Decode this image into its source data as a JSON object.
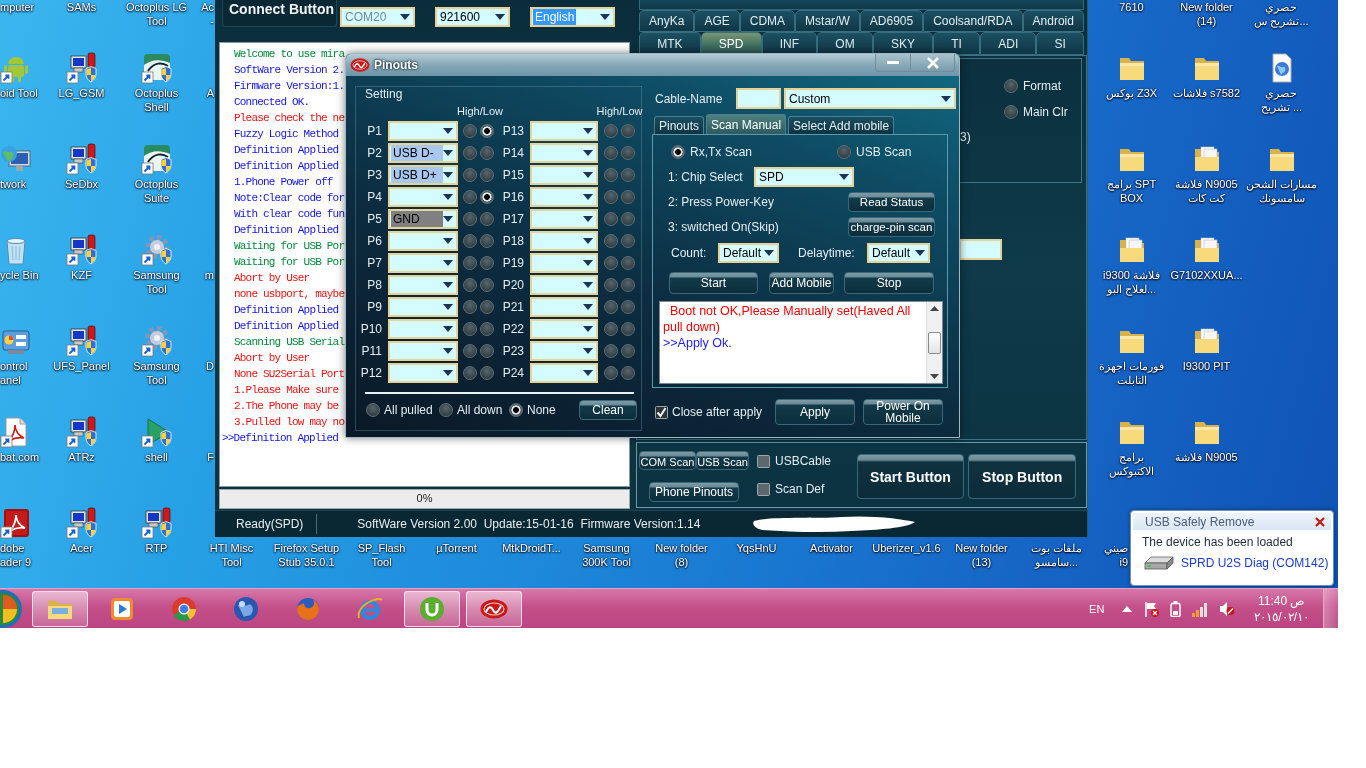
{
  "desktop": {
    "icons": [
      {
        "kind": "label",
        "label": "mputer"
      },
      {
        "kind": "android",
        "label": "oid Tool"
      },
      {
        "kind": "network",
        "label": "twork"
      },
      {
        "kind": "recycle",
        "label": "ycle Bin"
      },
      {
        "kind": "control",
        "label": "ontrol\nanel"
      },
      {
        "kind": "acrobat",
        "label": "bat.com"
      },
      {
        "kind": "reader",
        "label": "dobe\nader 9"
      },
      {
        "kind": "label",
        "label": "SAMs"
      },
      {
        "kind": "app",
        "label": "LG_GSM"
      },
      {
        "kind": "app",
        "label": "SeDbx"
      },
      {
        "kind": "app",
        "label": "KZF"
      },
      {
        "kind": "app",
        "label": "UFS_Panel"
      },
      {
        "kind": "app",
        "label": "ATRz"
      },
      {
        "kind": "app",
        "label": "Acer"
      },
      {
        "kind": "label",
        "label": "Octoplus LG\nTool"
      },
      {
        "kind": "octoplus",
        "label": "Octoplus\nShell"
      },
      {
        "kind": "octoplus",
        "label": "Octoplus\nSuite"
      },
      {
        "kind": "gear",
        "label": "Samsung\nTool"
      },
      {
        "kind": "gear",
        "label": "Samsung\nTool"
      },
      {
        "kind": "shell",
        "label": "shell"
      },
      {
        "kind": "app",
        "label": "RTP"
      },
      {
        "kind": "fragment",
        "label": "Ac\n-"
      },
      {
        "kind": "fragment",
        "label": "A"
      },
      {
        "kind": "fragment",
        "label": "m"
      },
      {
        "kind": "fragment",
        "label": "D"
      },
      {
        "kind": "fragment",
        "label": "F"
      },
      {
        "kind": "label",
        "label": "HTI Misc\nTool"
      },
      {
        "kind": "label",
        "label": "Firefox Setup\nStub 35.0.1"
      },
      {
        "kind": "label",
        "label": "SP_Flash\nTool"
      },
      {
        "kind": "label",
        "label": "µTorrent"
      },
      {
        "kind": "label",
        "label": "MtkDroidT..."
      },
      {
        "kind": "label",
        "label": "Samsung\n300K Tool"
      },
      {
        "kind": "label",
        "label": "New folder\n(8)"
      },
      {
        "kind": "label",
        "label": "YqsHnU"
      },
      {
        "kind": "label",
        "label": "Activator"
      },
      {
        "kind": "label",
        "label": "Uberizer_v1.6"
      },
      {
        "kind": "label",
        "label": "New folder\n(13)"
      },
      {
        "kind": "label",
        "label": "ملفات بوت\nسامسو..."
      },
      {
        "kind": "label",
        "label": "7610"
      },
      {
        "kind": "folder",
        "label": "بوكس Z3X"
      },
      {
        "kind": "folder",
        "label": "برامج SPT\nBOX"
      },
      {
        "kind": "files",
        "label": "i9300 فلاشة\nلعلاج البو..."
      },
      {
        "kind": "folder",
        "label": "فورمات اجهزة\nالتابلت"
      },
      {
        "kind": "folder",
        "label": "برامج\nالاكتبوكس"
      },
      {
        "kind": "covered",
        "label": "صيني\ni9"
      },
      {
        "kind": "label",
        "label": "New folder\n(14)"
      },
      {
        "kind": "folder",
        "label": "فلاشات s7582"
      },
      {
        "kind": "files",
        "label": "فلاشة N9005\nكت كات"
      },
      {
        "kind": "files",
        "label": "G7102XXUA..."
      },
      {
        "kind": "files",
        "label": "I9300 PIT"
      },
      {
        "kind": "folder",
        "label": "فلاشة N9005"
      },
      {
        "kind": "label",
        "label": "حصري\nتشريح س..."
      },
      {
        "kind": "web",
        "label": "حصري\nتشريح ..."
      },
      {
        "kind": "folder",
        "label": "مسارات الشحن\nسامسونك"
      }
    ]
  },
  "app": {
    "connect_button": "Connect Button",
    "ports": [
      {
        "value": "COM20",
        "disabled": true,
        "focused": false
      },
      {
        "value": "921600",
        "disabled": false,
        "focused": false
      },
      {
        "value": "English",
        "disabled": false,
        "focused": true
      }
    ],
    "platform_tabs": [
      {
        "tabs": [
          {
            "label": "AnyKa",
            "selected": false
          },
          {
            "label": "AGE",
            "selected": false
          },
          {
            "label": "CDMA",
            "selected": false
          },
          {
            "label": "Mstar/W",
            "selected": false
          },
          {
            "label": "AD6905",
            "selected": false
          },
          {
            "label": "Coolsand/RDA",
            "selected": false
          },
          {
            "label": "Android",
            "selected": false
          }
        ]
      },
      {
        "tabs": [
          {
            "label": "MTK",
            "selected": false
          },
          {
            "label": "SPD",
            "selected": true
          },
          {
            "label": "INF",
            "selected": false
          },
          {
            "label": "OM",
            "selected": false
          },
          {
            "label": "SKY",
            "selected": false
          },
          {
            "label": "TI",
            "selected": false
          },
          {
            "label": "ADI",
            "selected": false
          },
          {
            "label": "SI",
            "selected": false
          }
        ]
      }
    ],
    "log": [
      {
        "text": "Welcome to use mira",
        "kind": "status"
      },
      {
        "text": "SoftWare Version 2.",
        "kind": "info"
      },
      {
        "text": "Firmware Version:1.",
        "kind": "info"
      },
      {
        "text": "Connected OK.",
        "kind": "info"
      },
      {
        "text": "Please check the ne",
        "kind": "error"
      },
      {
        "text": "Fuzzy Logic Method",
        "kind": "info"
      },
      {
        "text": "Definition Applied",
        "kind": "info"
      },
      {
        "text": "Definition Applied",
        "kind": "info"
      },
      {
        "text": "1.Phone Power off",
        "kind": "info"
      },
      {
        "text": "Note:Clear code for",
        "kind": "info"
      },
      {
        "text": "With clear code fun",
        "kind": "info"
      },
      {
        "text": "Definition Applied",
        "kind": "info"
      },
      {
        "text": "Waiting for USB Por",
        "kind": "status"
      },
      {
        "text": "Waiting for USB Por",
        "kind": "status"
      },
      {
        "text": "Abort by User",
        "kind": "error"
      },
      {
        "text": "none usbport, maybe",
        "kind": "error"
      },
      {
        "text": "Definition Applied",
        "kind": "info"
      },
      {
        "text": "Definition Applied",
        "kind": "info"
      },
      {
        "text": "Scanning USB Serial",
        "kind": "status"
      },
      {
        "text": "Abort by User",
        "kind": "error"
      },
      {
        "text": "None SU2Serial Port",
        "kind": "error"
      },
      {
        "text": "1.Please Make sure",
        "kind": "error"
      },
      {
        "text": "2.The Phone may be",
        "kind": "error"
      },
      {
        "text": "3.Pulled low may no",
        "kind": "error"
      },
      {
        "text": ">>Definition Applied",
        "kind": "prompt"
      }
    ],
    "progress": {
      "text": "0%",
      "level": 0
    },
    "side_panel": {
      "options": [
        {
          "label": "Format",
          "selected": false
        },
        {
          "label": "Main Clr",
          "selected": false
        }
      ],
      "note": "3)"
    },
    "bottom_panel": {
      "scan_buttons": [
        "COM Scan",
        "USB Scan"
      ],
      "pinouts_button": "Phone Pinouts",
      "options": [
        {
          "label": "USBCable",
          "checked": false
        },
        {
          "label": "Scan Def",
          "checked": false
        }
      ],
      "actions": [
        "Start Button",
        "Stop Button"
      ]
    },
    "status_bar": [
      "Ready(SPD)",
      "SoftWare Version 2.00  Update:15-01-16  Firmware Version:1.14"
    ]
  },
  "pinouts_dialog": {
    "title": "Pinouts",
    "setting": {
      "title": "Setting",
      "headers": [
        "High/Low",
        "High/Low"
      ],
      "pins": [
        {
          "label": "P1",
          "high": false,
          "low": true
        },
        {
          "label": "P2",
          "value": "USB D-",
          "color": "#a8c8ee",
          "high": false,
          "low": false
        },
        {
          "label": "P3",
          "value": "USB D+",
          "color": "#a8c8ee",
          "high": false,
          "low": false
        },
        {
          "label": "P4",
          "high": false,
          "low": true
        },
        {
          "label": "P5",
          "value": "GND",
          "color": "#808080",
          "high": false,
          "low": false
        },
        {
          "label": "P6",
          "high": false,
          "low": false
        },
        {
          "label": "P7",
          "high": false,
          "low": false
        },
        {
          "label": "P8",
          "high": false,
          "low": false
        },
        {
          "label": "P9",
          "high": false,
          "low": false
        },
        {
          "label": "P10",
          "high": false,
          "low": false
        },
        {
          "label": "P11",
          "high": false,
          "low": false
        },
        {
          "label": "P12",
          "high": false,
          "low": false
        },
        {
          "label": "P13",
          "high": false,
          "low": false
        },
        {
          "label": "P14",
          "high": false,
          "low": false
        },
        {
          "label": "P15",
          "high": false,
          "low": false
        },
        {
          "label": "P16",
          "high": false,
          "low": false
        },
        {
          "label": "P17",
          "high": false,
          "low": false
        },
        {
          "label": "P18",
          "high": false,
          "low": false
        },
        {
          "label": "P19",
          "high": false,
          "low": false
        },
        {
          "label": "P20",
          "high": false,
          "low": false
        },
        {
          "label": "P21",
          "high": false,
          "low": false
        },
        {
          "label": "P22",
          "high": false,
          "low": false
        },
        {
          "label": "P23",
          "high": false,
          "low": false
        },
        {
          "label": "P24",
          "high": false,
          "low": false
        }
      ],
      "modes": [
        {
          "label": "All pulled",
          "selected": false
        },
        {
          "label": "All down",
          "selected": false
        },
        {
          "label": "None",
          "selected": true
        }
      ],
      "clean_button": "Clean"
    },
    "cable_name": {
      "label": "Cable-Name",
      "value": "Custom"
    },
    "tabs": [
      {
        "label": "Pinouts",
        "selected": false
      },
      {
        "label": "Scan Manual",
        "selected": true
      },
      {
        "label": "Select Add mobile",
        "selected": false
      }
    ],
    "scan_manual": {
      "scan_types": [
        {
          "label": "Rx,Tx Scan",
          "selected": true
        },
        {
          "label": "USB Scan",
          "selected": false
        }
      ],
      "steps": [
        {
          "kind": "select",
          "label": "1: Chip Select",
          "value": "SPD"
        },
        {
          "kind": "button",
          "label": "2: Press Power-Key",
          "button": "Read Status"
        },
        {
          "kind": "button",
          "label": "3: switched On(Skip)",
          "button": "charge-pin scan"
        }
      ],
      "count": {
        "label": "Count:",
        "value": "Default"
      },
      "delay": {
        "label": "Delaytime:",
        "value": "Default"
      },
      "buttons": [
        "Start",
        "Add Mobile",
        "Stop"
      ],
      "messages": [
        {
          "kind": "error",
          "text": "  Boot not OK,Please Manually set(Haved All pull down)"
        },
        {
          "kind": "info",
          "text": ">>Apply Ok."
        }
      ]
    },
    "close_after_apply": {
      "label": "Close after apply",
      "checked": true
    },
    "buttons": [
      "Apply",
      "Power On Mobile"
    ]
  },
  "notification": {
    "title": "USB Safely Remove",
    "message": "The device has been loaded",
    "device": "SPRD U2S Diag (COM142)"
  },
  "taskbar": {
    "buttons": [
      {
        "kind": "folder",
        "running": true
      },
      {
        "kind": "media",
        "running": false
      },
      {
        "kind": "chrome",
        "running": false
      },
      {
        "kind": "globe",
        "running": false
      },
      {
        "kind": "firefox",
        "running": false
      },
      {
        "kind": "ie",
        "running": false
      },
      {
        "kind": "utorrent",
        "running": true
      },
      {
        "kind": "app",
        "running": true
      }
    ],
    "language": "EN",
    "time": "11:40 ص",
    "date": "٢٠١٥/٠٢/١٠"
  }
}
